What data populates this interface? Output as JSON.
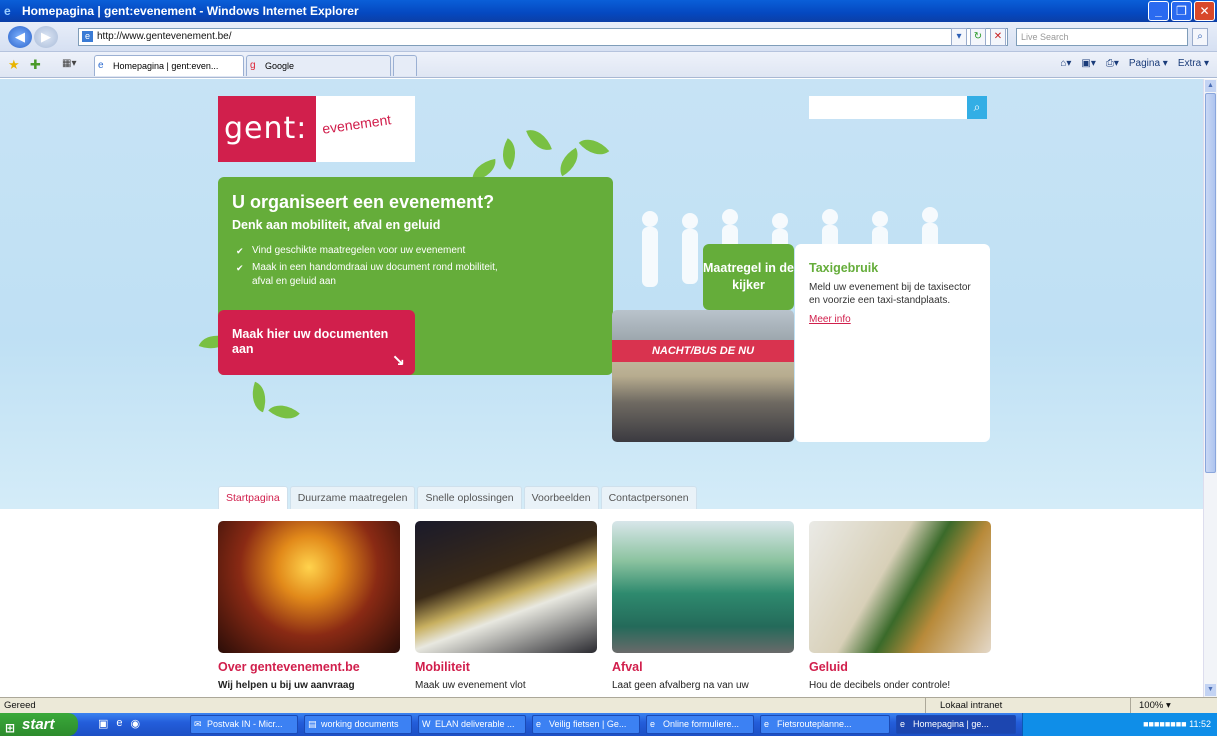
{
  "window": {
    "title": "Homepagina | gent:evenement - Windows Internet Explorer"
  },
  "browser": {
    "url": "http://www.gentevenement.be/",
    "search_placeholder": "Live Search",
    "tabs": [
      {
        "label": "Homepagina | gent:even..."
      },
      {
        "label": "Google"
      }
    ],
    "tools": {
      "page": "Pagina",
      "extra": "Extra"
    }
  },
  "site": {
    "logo_main": "gent:",
    "logo_sub": "evenement",
    "hero": {
      "title": "U organiseert een evenement?",
      "subtitle": "Denk aan mobiliteit, afval en geluid",
      "bullets": [
        "Vind geschikte maatregelen voor uw evenement",
        "Maak in een handomdraai uw document rond mobiliteit, afval en geluid aan"
      ],
      "cta": "Maak hier uw documenten aan"
    },
    "spotlight": {
      "tag": "Maatregel in de kijker",
      "banner": "NACHT/BUS DE NU"
    },
    "taxi": {
      "title": "Taxigebruik",
      "text": "Meld uw evenement bij de taxisector en voorzie een taxi-standplaats.",
      "link": "Meer info"
    },
    "nav": [
      "Startpagina",
      "Duurzame maatregelen",
      "Snelle oplossingen",
      "Voorbeelden",
      "Contactpersonen"
    ],
    "cards": [
      {
        "title": "Over gentevenement.be",
        "text": "Wij helpen u bij uw aanvraag"
      },
      {
        "title": "Mobiliteit",
        "text": "Maak uw evenement vlot"
      },
      {
        "title": "Afval",
        "text": "Laat geen afvalberg na van uw"
      },
      {
        "title": "Geluid",
        "text": "Hou de decibels onder controle!"
      }
    ]
  },
  "status": {
    "text": "Gereed",
    "zone": "Lokaal intranet",
    "zoom": "100%"
  },
  "taskbar": {
    "start": "start",
    "items": [
      "Postvak IN - Micr...",
      "working documents",
      "ELAN deliverable ...",
      "Veilig fietsen | Ge...",
      "Online formuliere...",
      "Fietsrouteplanne...",
      "Homepagina | ge..."
    ],
    "clock": "11:52"
  },
  "colors": {
    "brand_red": "#d11f4c",
    "brand_green": "#65ad3a",
    "sky": "#c7e3f5"
  }
}
